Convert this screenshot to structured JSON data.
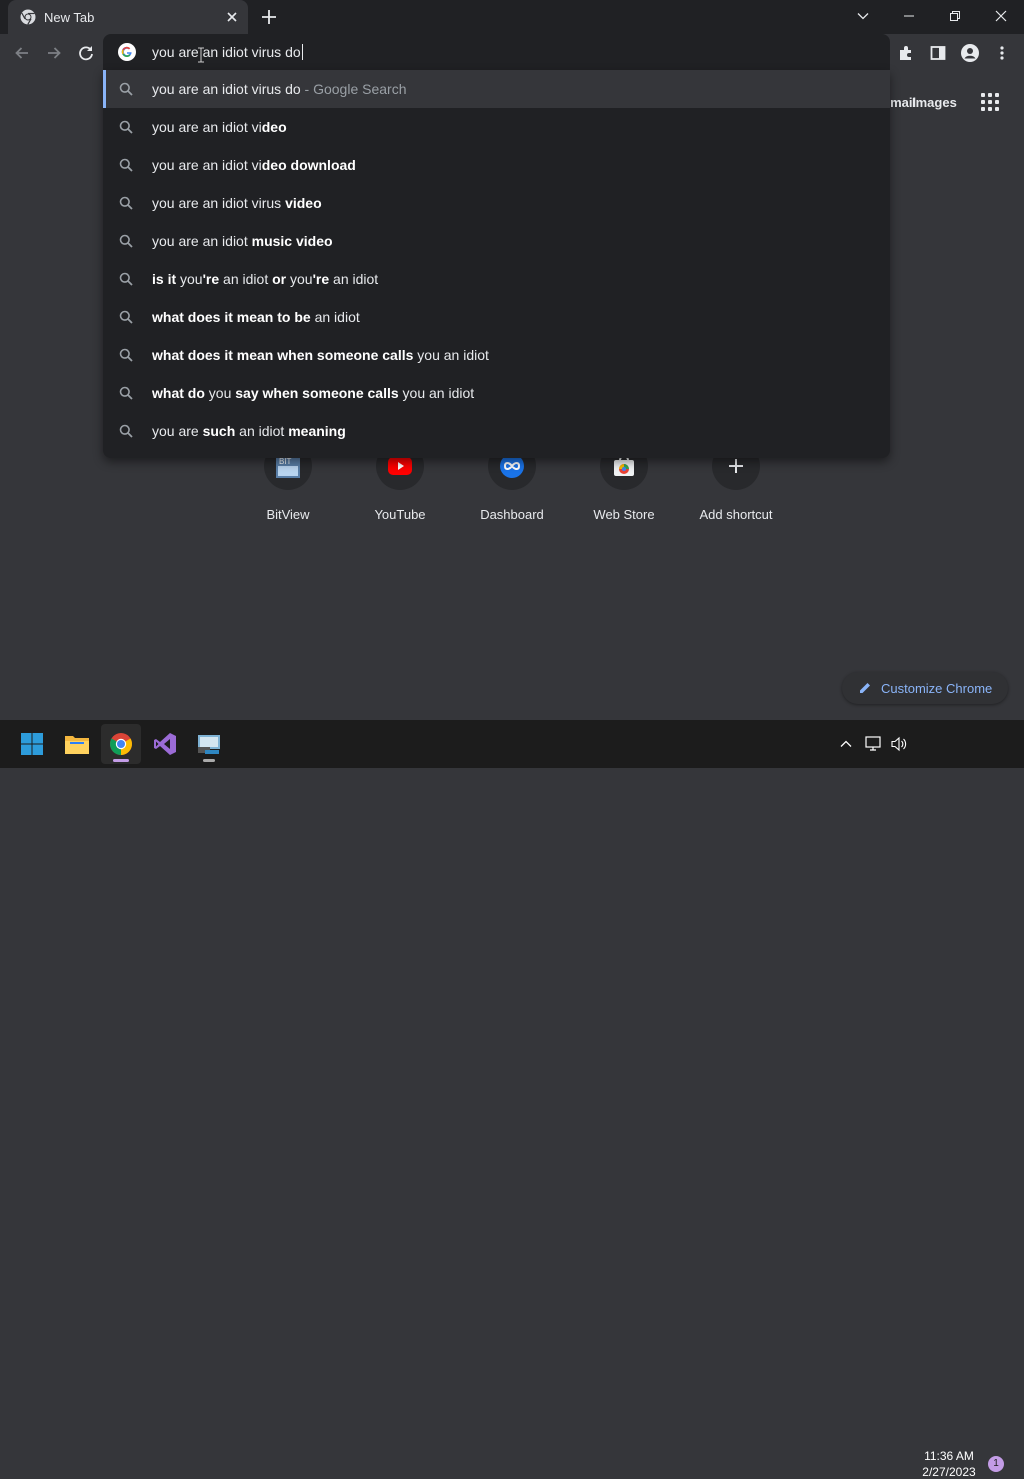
{
  "browser": {
    "tab": {
      "title": "New Tab"
    },
    "window_controls": [
      "tab-search",
      "minimize",
      "maximize",
      "close"
    ]
  },
  "omnibox": {
    "text": "you are an idiot virus do"
  },
  "suggestions": [
    {
      "parts": [
        {
          "t": "you are an idiot virus do",
          "b": false
        },
        {
          "t": " - Google Search",
          "b": false,
          "sub": true
        }
      ],
      "selected": true
    },
    {
      "parts": [
        {
          "t": "you are an idiot vi",
          "b": false
        },
        {
          "t": "deo",
          "b": true
        }
      ]
    },
    {
      "parts": [
        {
          "t": "you are an idiot vi",
          "b": false
        },
        {
          "t": "deo download",
          "b": true
        }
      ]
    },
    {
      "parts": [
        {
          "t": "you are an idiot virus ",
          "b": false
        },
        {
          "t": "video",
          "b": true
        }
      ]
    },
    {
      "parts": [
        {
          "t": "you are an idiot ",
          "b": false
        },
        {
          "t": "music video",
          "b": true
        }
      ]
    },
    {
      "parts": [
        {
          "t": "is it ",
          "b": true
        },
        {
          "t": "you",
          "b": false
        },
        {
          "t": "'re",
          "b": true
        },
        {
          "t": " an idiot ",
          "b": false
        },
        {
          "t": "or ",
          "b": true
        },
        {
          "t": "you",
          "b": false
        },
        {
          "t": "'re",
          "b": true
        },
        {
          "t": " an idiot",
          "b": false
        }
      ]
    },
    {
      "parts": [
        {
          "t": "what does it mean to be ",
          "b": true
        },
        {
          "t": "an idiot",
          "b": false
        }
      ]
    },
    {
      "parts": [
        {
          "t": "what does it mean when someone calls ",
          "b": true
        },
        {
          "t": "you an idiot",
          "b": false
        }
      ]
    },
    {
      "parts": [
        {
          "t": "what do ",
          "b": true
        },
        {
          "t": "you ",
          "b": false
        },
        {
          "t": "say when someone calls ",
          "b": true
        },
        {
          "t": "you an idiot",
          "b": false
        }
      ]
    },
    {
      "parts": [
        {
          "t": "you are ",
          "b": false
        },
        {
          "t": "such",
          "b": true
        },
        {
          "t": " an idiot ",
          "b": false
        },
        {
          "t": "meaning",
          "b": true
        }
      ]
    }
  ],
  "header_links": {
    "gmail": "Gmail",
    "images": "Images"
  },
  "shortcuts": [
    {
      "label": "BitView",
      "icon": "bitview-icon"
    },
    {
      "label": "YouTube",
      "icon": "youtube-icon"
    },
    {
      "label": "Dashboard",
      "icon": "dashboard-icon"
    },
    {
      "label": "Web Store",
      "icon": "web-store-icon"
    },
    {
      "label": "Add shortcut",
      "icon": "plus-icon"
    }
  ],
  "customize": {
    "label": "Customize Chrome"
  },
  "taskbar": {
    "apps": [
      "start-icon",
      "file-explorer-icon",
      "chrome-icon",
      "visual-studio-icon",
      "remote-desktop-icon"
    ],
    "clock": {
      "time": "11:36 AM",
      "date": "2/27/2023"
    },
    "notifications": "1"
  },
  "colors": {
    "accent": "#8ab4f8",
    "background": "#35363a",
    "popup": "#202124"
  }
}
